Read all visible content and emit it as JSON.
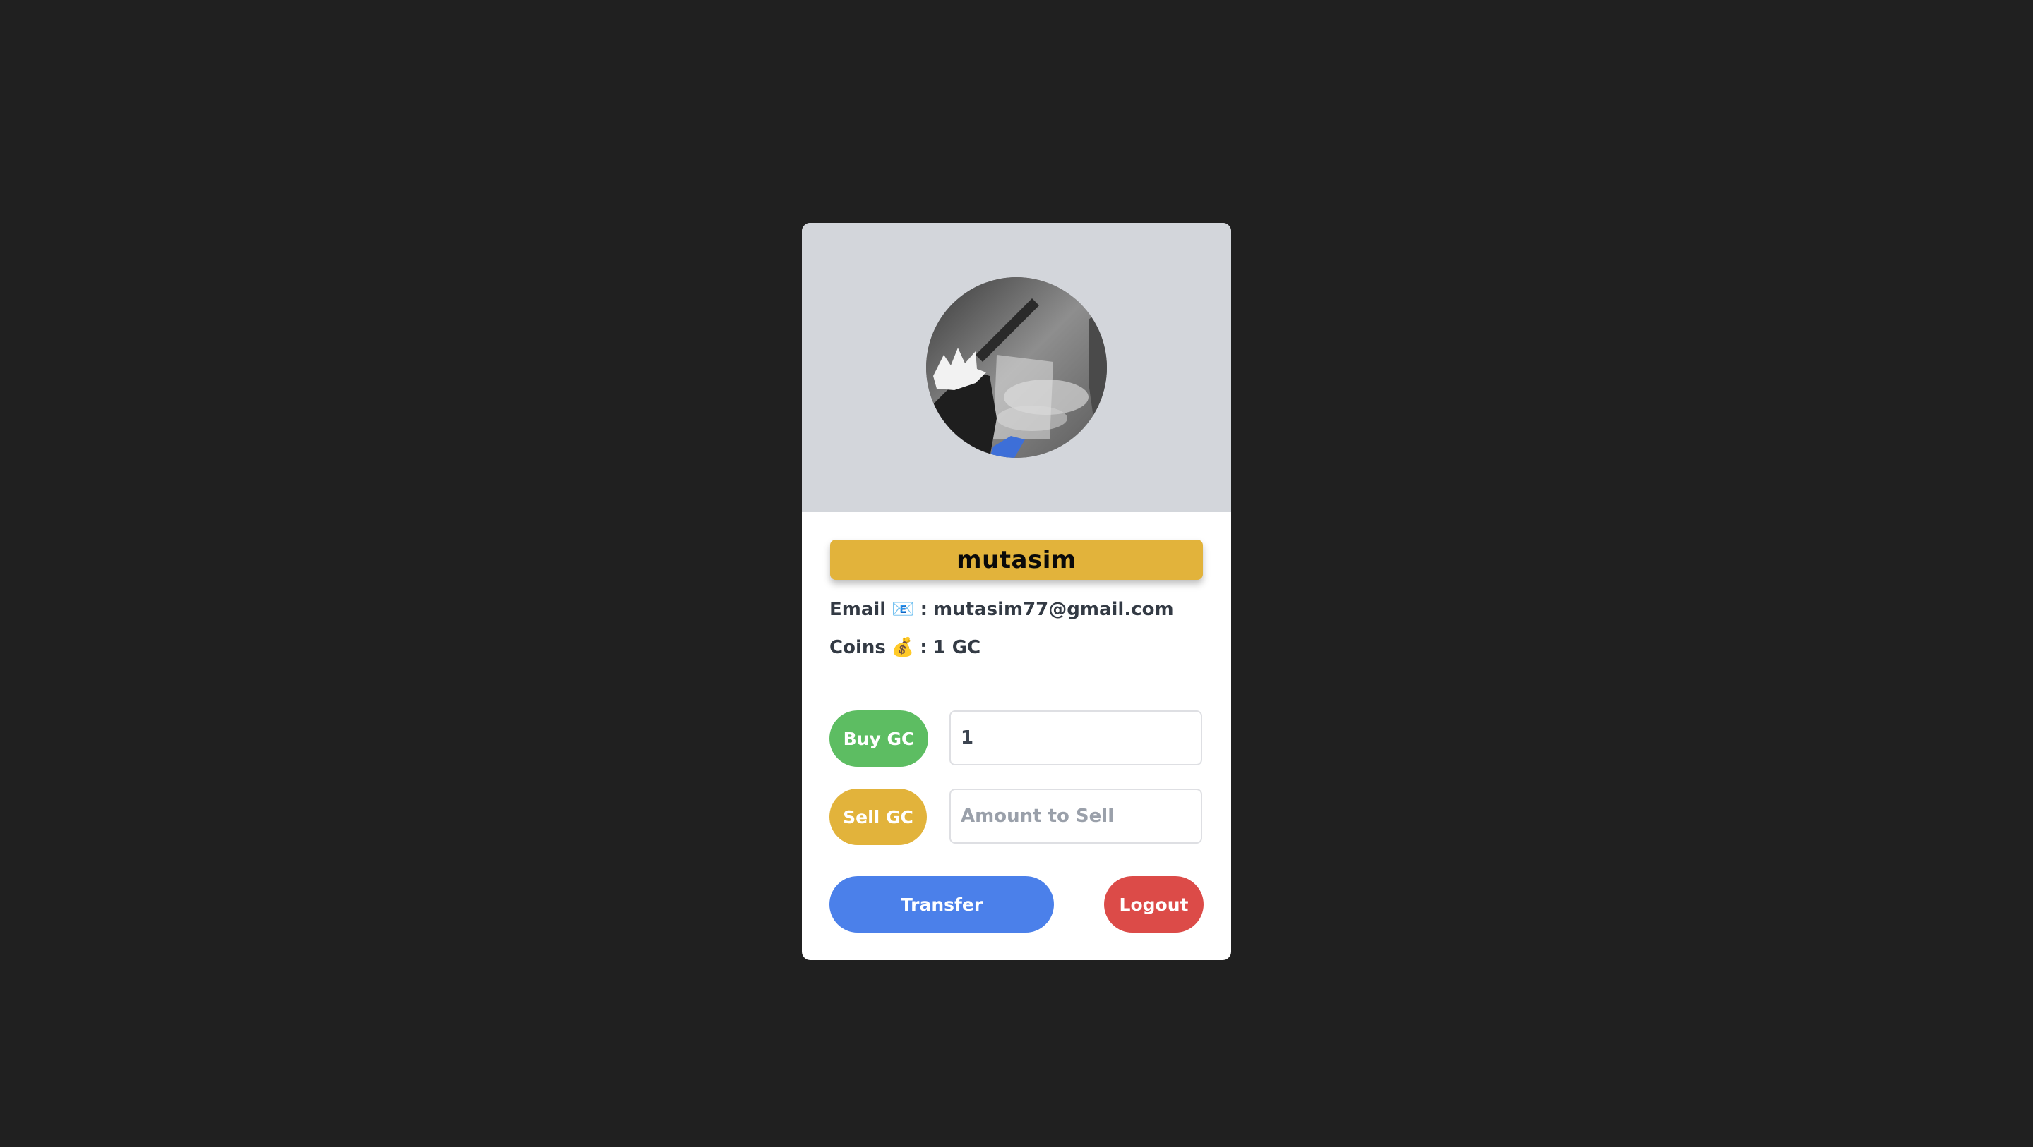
{
  "profile": {
    "username": "mutasim",
    "email_label": "Email",
    "email_icon": "📧",
    "email_sep": ":",
    "email": "mutasim77@gmail.com",
    "coins_label": "Coins",
    "coins_icon": "💰",
    "coins_sep": ":",
    "coins_value": "1 GC"
  },
  "actions": {
    "buy_label": "Buy GC",
    "buy_value": "1",
    "sell_label": "Sell GC",
    "sell_placeholder": "Amount to Sell",
    "transfer_label": "Transfer",
    "logout_label": "Logout"
  },
  "colors": {
    "background": "#202020",
    "card_header": "#d3d6db",
    "name_bar": "#e2b33b",
    "buy": "#5dbd62",
    "sell": "#e2b33b",
    "transfer": "#4b80ea",
    "logout": "#dc4b48"
  }
}
